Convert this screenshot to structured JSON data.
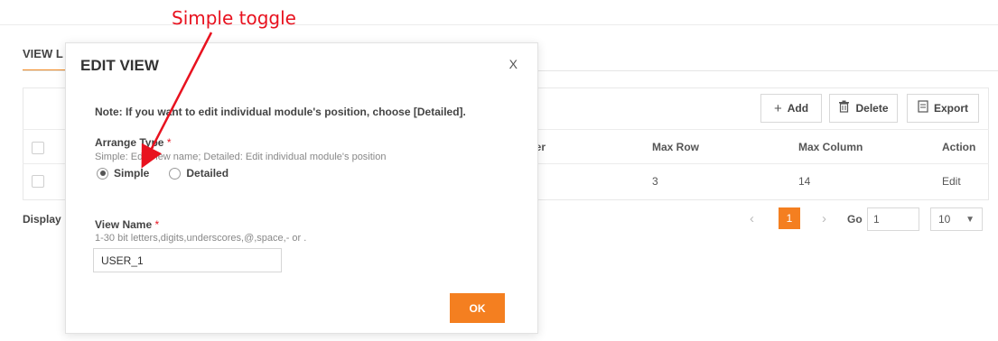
{
  "annotation": {
    "label": "Simple toggle",
    "color": "#e8121f"
  },
  "page": {
    "tab_label": "VIEW L",
    "toolbar": {
      "add_label": "Add",
      "delete_label": "Delete",
      "export_label": "Export"
    },
    "table": {
      "headers": {
        "number": "nber",
        "max_row": "Max Row",
        "max_column": "Max Column",
        "action": "Action"
      },
      "row": {
        "max_row": "3",
        "max_column": "14",
        "action": "Edit"
      }
    },
    "footer": {
      "display_label": "Display",
      "current_page": "1",
      "go_label": "Go",
      "go_value": "1",
      "page_size": "10"
    }
  },
  "modal": {
    "title": "EDIT VIEW",
    "close_label": "X",
    "note": "Note:   If you want to edit individual module's position, choose [Detailed].",
    "arrange_type": {
      "label": "Arrange Type",
      "required_mark": "*",
      "hint": "Simple: Edit view name; Detailed: Edit individual module's position",
      "options": [
        "Simple",
        "Detailed"
      ],
      "selected": "Simple"
    },
    "view_name": {
      "label": "View Name",
      "required_mark": "*",
      "hint": "1-30 bit letters,digits,underscores,@,space,- or .",
      "value": "USER_1"
    },
    "ok_label": "OK"
  },
  "colors": {
    "accent": "#f47f20",
    "annotation": "#e8121f"
  }
}
